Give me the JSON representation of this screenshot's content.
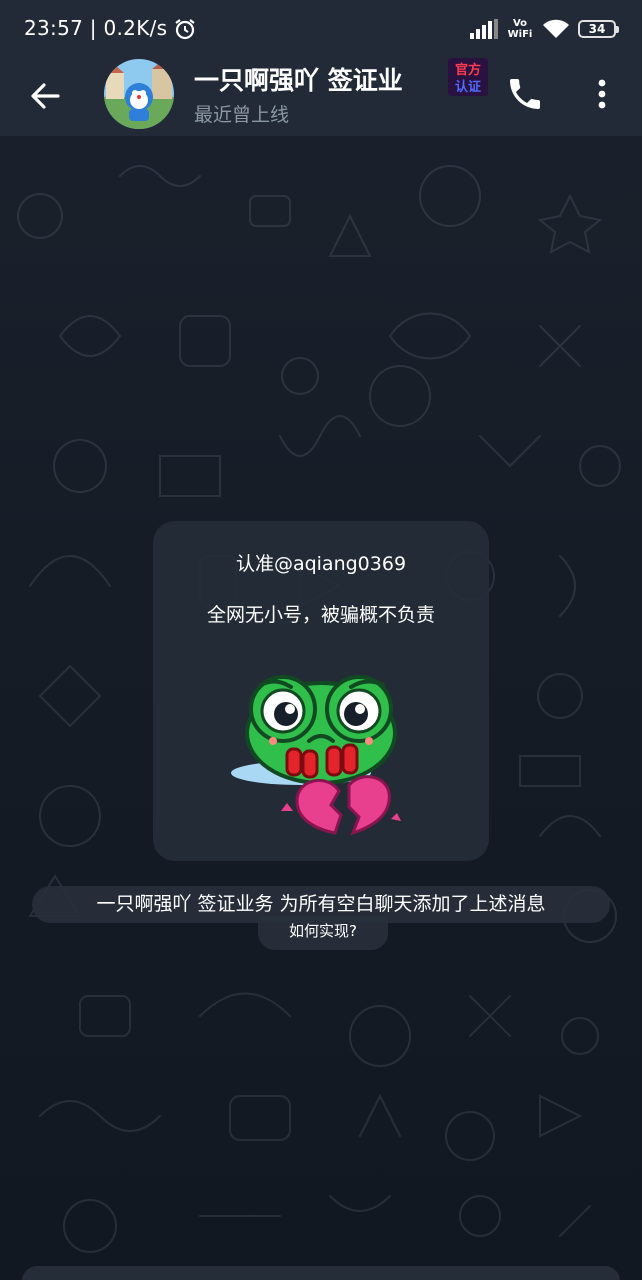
{
  "status_bar": {
    "time": "23:57 | 0.2K/s",
    "network_label_top": "Vo",
    "network_label_bottom": "WiFi",
    "battery_level": "34",
    "icons": [
      "alarm-icon",
      "signal-icon",
      "wifi-icon",
      "battery-icon"
    ]
  },
  "header": {
    "title": "一只啊强吖 签证业",
    "subtitle": "最近曾上线",
    "badge_lines": [
      "官方",
      "认证"
    ],
    "icons": [
      "back-arrow-icon",
      "phone-icon",
      "more-vert-icon"
    ]
  },
  "greeting": {
    "title": "认准@aqiang0369",
    "text": "全网无小号，被骗概不负责",
    "sticker": "crying-frog-broken-heart-sticker"
  },
  "service_message": {
    "text": "一只啊强吖 签证业务 为所有空白聊天添加了上述消息",
    "link": "如何实现?"
  },
  "colors": {
    "header_bg": "#212a36",
    "chat_bg": "#161c26",
    "card_bg": "#252d38",
    "subtitle": "#8c97a6",
    "frog_green": "#2fbf4a",
    "heart_pink": "#e8408f"
  }
}
